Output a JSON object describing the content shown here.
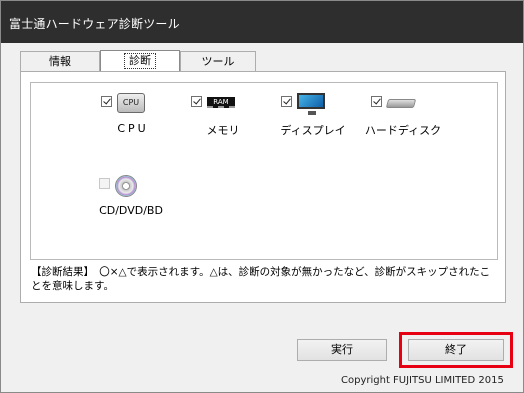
{
  "window": {
    "title": "富士通ハードウェア診断ツール"
  },
  "tabs": [
    {
      "label": "情報",
      "active": false
    },
    {
      "label": "診断",
      "active": true
    },
    {
      "label": "ツール",
      "active": false
    }
  ],
  "devices": [
    {
      "label": "CPU",
      "icon": "cpu-icon",
      "icon_text": "CPU",
      "checked": true,
      "enabled": true
    },
    {
      "label": "メモリ",
      "icon": "memory-icon",
      "icon_text": "RAM",
      "checked": true,
      "enabled": true
    },
    {
      "label": "ディスプレイ",
      "icon": "display-icon",
      "checked": true,
      "enabled": true
    },
    {
      "label": "ハードディスク",
      "icon": "hard-disk-icon",
      "checked": true,
      "enabled": true
    },
    {
      "label": "CD/DVD/BD",
      "icon": "optical-disc-icon",
      "checked": false,
      "enabled": false
    }
  ],
  "result_text": "【診断結果】　〇×△で表示されます。△は、診断の対象が無かったなど、診断がスキップされたことを意味します。",
  "buttons": {
    "run_label": "実行",
    "end_label": "終了"
  },
  "highlight_color": "#e60012",
  "copyright": "Copyright FUJITSU LIMITED 2015"
}
